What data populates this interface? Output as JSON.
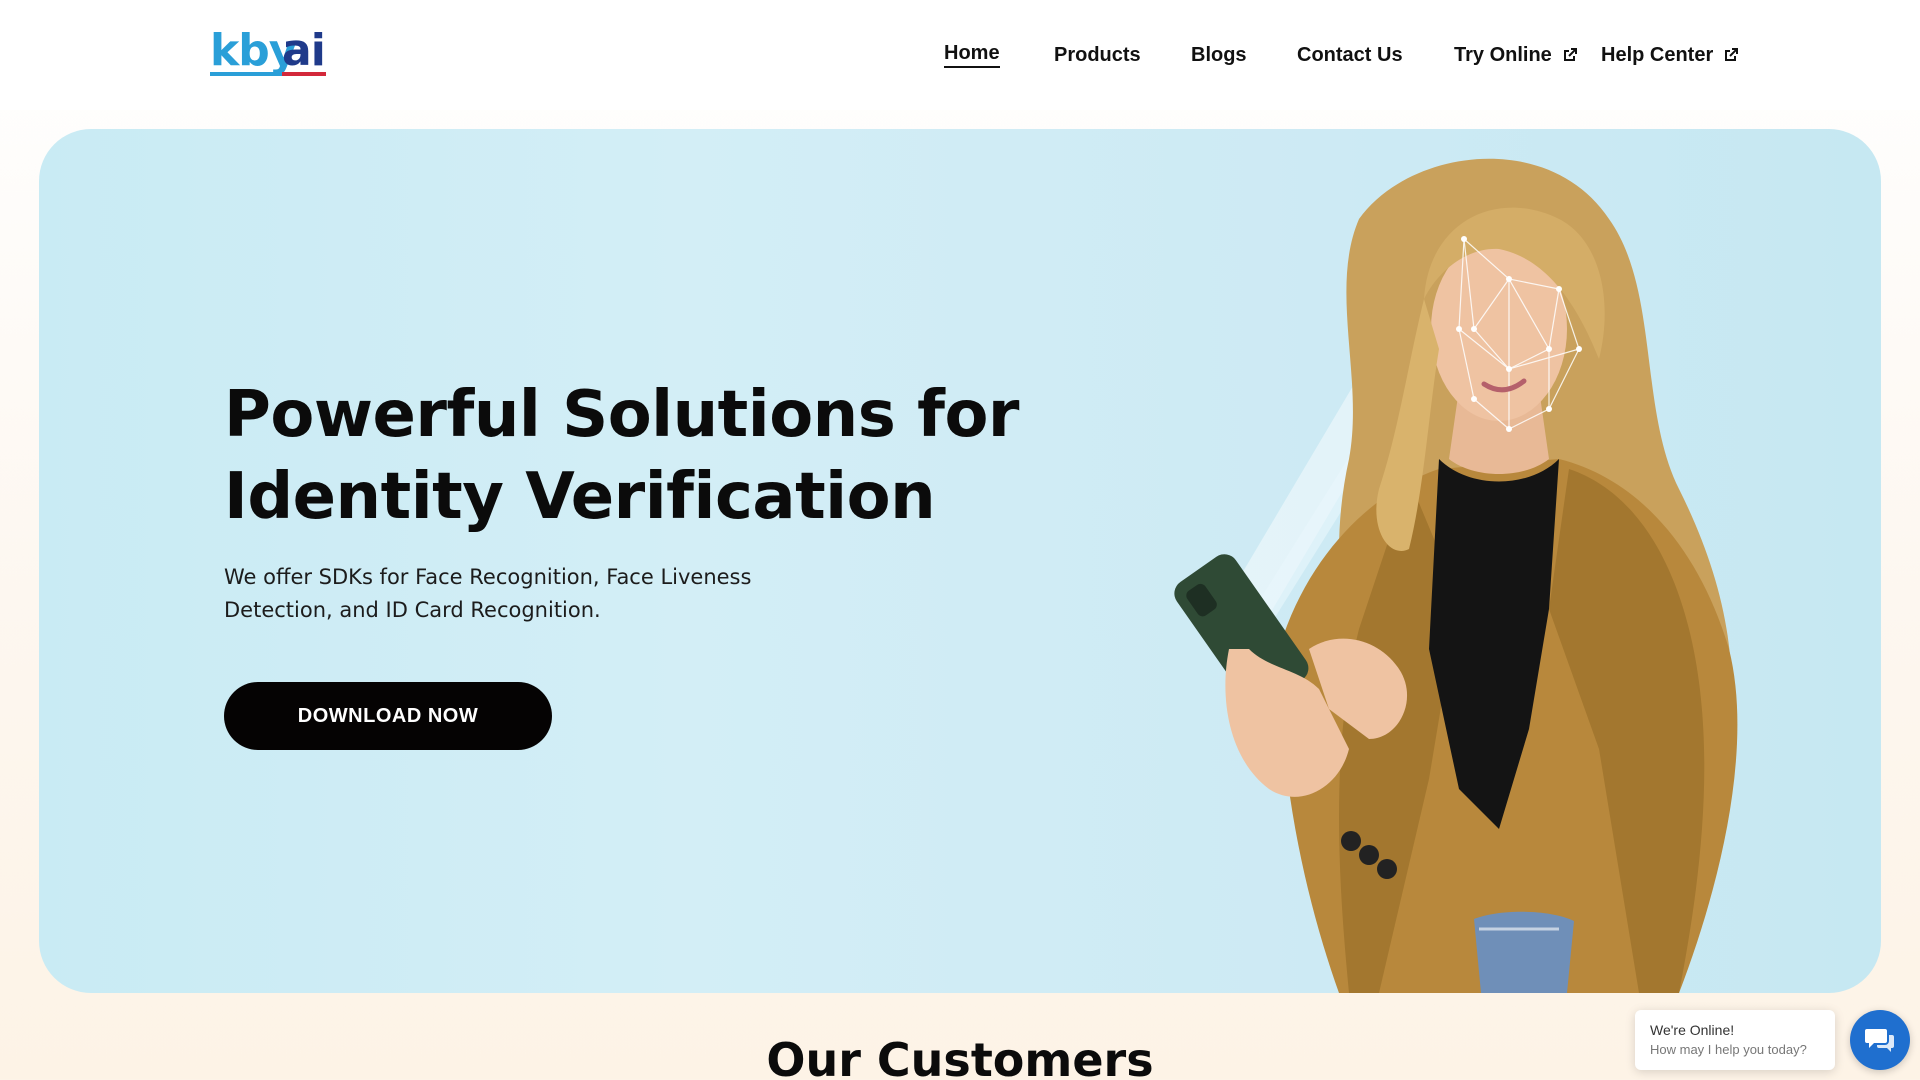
{
  "logo": {
    "part1": "kby",
    "part2": "ai"
  },
  "nav": {
    "home": "Home",
    "products": "Products",
    "blogs": "Blogs",
    "contact": "Contact Us",
    "try_online": "Try Online",
    "help_center": "Help Center"
  },
  "hero": {
    "title_line1": "Powerful Solutions for",
    "title_line2": "Identity Verification",
    "subtitle": "We offer SDKs for Face Recognition, Face Liveness Detection, and ID Card Recognition.",
    "cta_label": "DOWNLOAD NOW"
  },
  "customers": {
    "heading": "Our Customers"
  },
  "chat": {
    "status": "We're Online!",
    "message": "How may I help you today?"
  },
  "colors": {
    "brand_blue": "#2a9fd8",
    "brand_navy": "#1f3a8a",
    "brand_red": "#d3283a",
    "hero_bg": "#cdeaf4",
    "cta_bg": "#050303",
    "chat_accent": "#1f6fcf"
  },
  "icons": {
    "external_link": "external-link-icon",
    "chat": "chat-icon"
  }
}
